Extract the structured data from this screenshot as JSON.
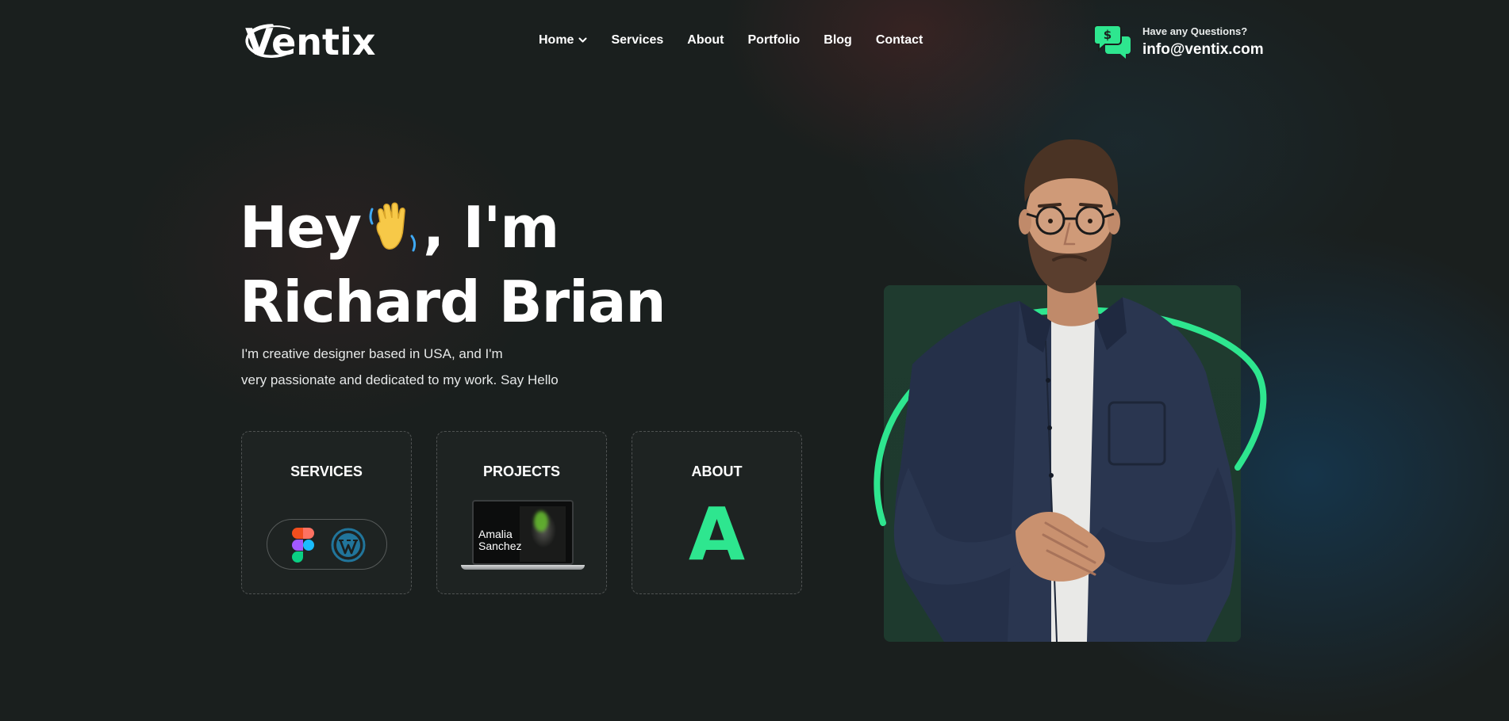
{
  "brand": {
    "name": "Ventix"
  },
  "nav": {
    "items": [
      {
        "label": "Home",
        "has_dropdown": true
      },
      {
        "label": "Services"
      },
      {
        "label": "About"
      },
      {
        "label": "Portfolio"
      },
      {
        "label": "Blog"
      },
      {
        "label": "Contact"
      }
    ]
  },
  "contact": {
    "question": "Have any Questions?",
    "email": "info@ventix.com",
    "icon": "chat-dollar-icon"
  },
  "hero": {
    "title_line1_start": "Hey",
    "title_line1_end": ", I'm",
    "title_line2": "Richard Brian",
    "description_line1": "I'm creative designer based in USA, and I'm",
    "description_line2": "very passionate and dedicated to my work. Say Hello"
  },
  "cards": {
    "services": {
      "title": "SERVICES",
      "tools": [
        "figma-icon",
        "wordpress-icon"
      ]
    },
    "projects": {
      "title": "PROJECTS",
      "preview_caption_line1": "Amalia",
      "preview_caption_line2": "Sanchez"
    },
    "about": {
      "title": "ABOUT",
      "letter": "A"
    }
  },
  "colors": {
    "accent": "#2ee68f",
    "background": "#1a1f1e",
    "panel": "#1f3b2f"
  }
}
